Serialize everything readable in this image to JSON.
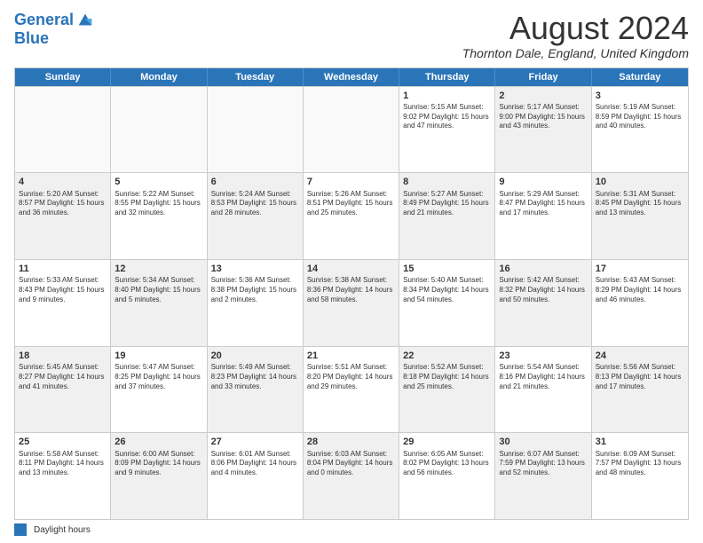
{
  "logo": {
    "line1": "General",
    "line2": "Blue"
  },
  "title": "August 2024",
  "location": "Thornton Dale, England, United Kingdom",
  "days_header": [
    "Sunday",
    "Monday",
    "Tuesday",
    "Wednesday",
    "Thursday",
    "Friday",
    "Saturday"
  ],
  "footer_label": "Daylight hours",
  "weeks": [
    [
      {
        "day": "",
        "info": "",
        "empty": true
      },
      {
        "day": "",
        "info": "",
        "empty": true
      },
      {
        "day": "",
        "info": "",
        "empty": true
      },
      {
        "day": "",
        "info": "",
        "empty": true
      },
      {
        "day": "1",
        "info": "Sunrise: 5:15 AM\nSunset: 9:02 PM\nDaylight: 15 hours\nand 47 minutes.",
        "empty": false,
        "shaded": false
      },
      {
        "day": "2",
        "info": "Sunrise: 5:17 AM\nSunset: 9:00 PM\nDaylight: 15 hours\nand 43 minutes.",
        "empty": false,
        "shaded": true
      },
      {
        "day": "3",
        "info": "Sunrise: 5:19 AM\nSunset: 8:59 PM\nDaylight: 15 hours\nand 40 minutes.",
        "empty": false,
        "shaded": false
      }
    ],
    [
      {
        "day": "4",
        "info": "Sunrise: 5:20 AM\nSunset: 8:57 PM\nDaylight: 15 hours\nand 36 minutes.",
        "empty": false,
        "shaded": true
      },
      {
        "day": "5",
        "info": "Sunrise: 5:22 AM\nSunset: 8:55 PM\nDaylight: 15 hours\nand 32 minutes.",
        "empty": false,
        "shaded": false
      },
      {
        "day": "6",
        "info": "Sunrise: 5:24 AM\nSunset: 8:53 PM\nDaylight: 15 hours\nand 28 minutes.",
        "empty": false,
        "shaded": true
      },
      {
        "day": "7",
        "info": "Sunrise: 5:26 AM\nSunset: 8:51 PM\nDaylight: 15 hours\nand 25 minutes.",
        "empty": false,
        "shaded": false
      },
      {
        "day": "8",
        "info": "Sunrise: 5:27 AM\nSunset: 8:49 PM\nDaylight: 15 hours\nand 21 minutes.",
        "empty": false,
        "shaded": true
      },
      {
        "day": "9",
        "info": "Sunrise: 5:29 AM\nSunset: 8:47 PM\nDaylight: 15 hours\nand 17 minutes.",
        "empty": false,
        "shaded": false
      },
      {
        "day": "10",
        "info": "Sunrise: 5:31 AM\nSunset: 8:45 PM\nDaylight: 15 hours\nand 13 minutes.",
        "empty": false,
        "shaded": true
      }
    ],
    [
      {
        "day": "11",
        "info": "Sunrise: 5:33 AM\nSunset: 8:43 PM\nDaylight: 15 hours\nand 9 minutes.",
        "empty": false,
        "shaded": false
      },
      {
        "day": "12",
        "info": "Sunrise: 5:34 AM\nSunset: 8:40 PM\nDaylight: 15 hours\nand 5 minutes.",
        "empty": false,
        "shaded": true
      },
      {
        "day": "13",
        "info": "Sunrise: 5:36 AM\nSunset: 8:38 PM\nDaylight: 15 hours\nand 2 minutes.",
        "empty": false,
        "shaded": false
      },
      {
        "day": "14",
        "info": "Sunrise: 5:38 AM\nSunset: 8:36 PM\nDaylight: 14 hours\nand 58 minutes.",
        "empty": false,
        "shaded": true
      },
      {
        "day": "15",
        "info": "Sunrise: 5:40 AM\nSunset: 8:34 PM\nDaylight: 14 hours\nand 54 minutes.",
        "empty": false,
        "shaded": false
      },
      {
        "day": "16",
        "info": "Sunrise: 5:42 AM\nSunset: 8:32 PM\nDaylight: 14 hours\nand 50 minutes.",
        "empty": false,
        "shaded": true
      },
      {
        "day": "17",
        "info": "Sunrise: 5:43 AM\nSunset: 8:29 PM\nDaylight: 14 hours\nand 46 minutes.",
        "empty": false,
        "shaded": false
      }
    ],
    [
      {
        "day": "18",
        "info": "Sunrise: 5:45 AM\nSunset: 8:27 PM\nDaylight: 14 hours\nand 41 minutes.",
        "empty": false,
        "shaded": true
      },
      {
        "day": "19",
        "info": "Sunrise: 5:47 AM\nSunset: 8:25 PM\nDaylight: 14 hours\nand 37 minutes.",
        "empty": false,
        "shaded": false
      },
      {
        "day": "20",
        "info": "Sunrise: 5:49 AM\nSunset: 8:23 PM\nDaylight: 14 hours\nand 33 minutes.",
        "empty": false,
        "shaded": true
      },
      {
        "day": "21",
        "info": "Sunrise: 5:51 AM\nSunset: 8:20 PM\nDaylight: 14 hours\nand 29 minutes.",
        "empty": false,
        "shaded": false
      },
      {
        "day": "22",
        "info": "Sunrise: 5:52 AM\nSunset: 8:18 PM\nDaylight: 14 hours\nand 25 minutes.",
        "empty": false,
        "shaded": true
      },
      {
        "day": "23",
        "info": "Sunrise: 5:54 AM\nSunset: 8:16 PM\nDaylight: 14 hours\nand 21 minutes.",
        "empty": false,
        "shaded": false
      },
      {
        "day": "24",
        "info": "Sunrise: 5:56 AM\nSunset: 8:13 PM\nDaylight: 14 hours\nand 17 minutes.",
        "empty": false,
        "shaded": true
      }
    ],
    [
      {
        "day": "25",
        "info": "Sunrise: 5:58 AM\nSunset: 8:11 PM\nDaylight: 14 hours\nand 13 minutes.",
        "empty": false,
        "shaded": false
      },
      {
        "day": "26",
        "info": "Sunrise: 6:00 AM\nSunset: 8:09 PM\nDaylight: 14 hours\nand 9 minutes.",
        "empty": false,
        "shaded": true
      },
      {
        "day": "27",
        "info": "Sunrise: 6:01 AM\nSunset: 8:06 PM\nDaylight: 14 hours\nand 4 minutes.",
        "empty": false,
        "shaded": false
      },
      {
        "day": "28",
        "info": "Sunrise: 6:03 AM\nSunset: 8:04 PM\nDaylight: 14 hours\nand 0 minutes.",
        "empty": false,
        "shaded": true
      },
      {
        "day": "29",
        "info": "Sunrise: 6:05 AM\nSunset: 8:02 PM\nDaylight: 13 hours\nand 56 minutes.",
        "empty": false,
        "shaded": false
      },
      {
        "day": "30",
        "info": "Sunrise: 6:07 AM\nSunset: 7:59 PM\nDaylight: 13 hours\nand 52 minutes.",
        "empty": false,
        "shaded": true
      },
      {
        "day": "31",
        "info": "Sunrise: 6:09 AM\nSunset: 7:57 PM\nDaylight: 13 hours\nand 48 minutes.",
        "empty": false,
        "shaded": false
      }
    ]
  ]
}
